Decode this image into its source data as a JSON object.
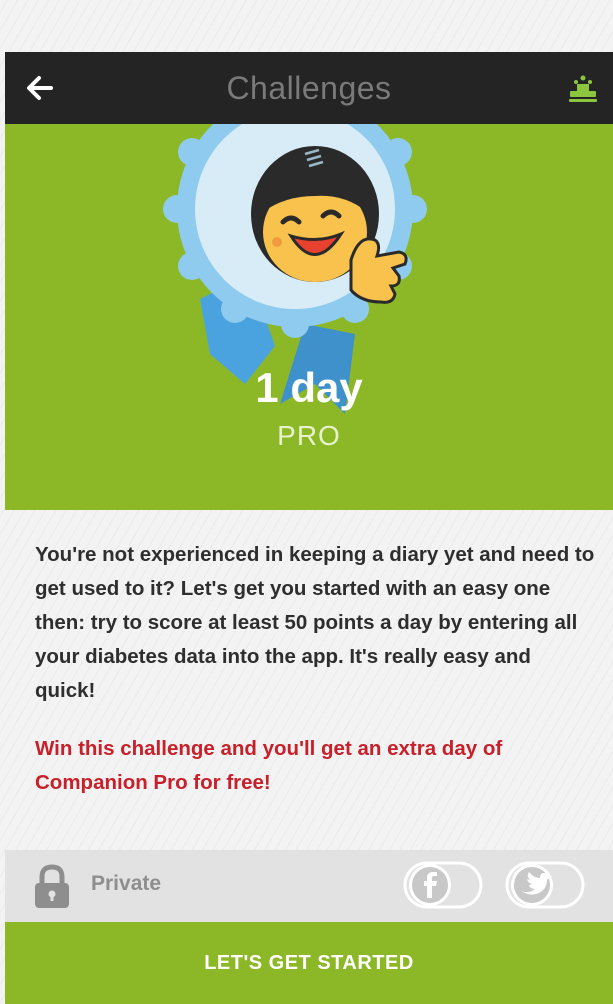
{
  "header": {
    "title": "Challenges",
    "back_icon": "back-arrow-icon",
    "share_icon": "podium-icon"
  },
  "challenge": {
    "duration": "1 day",
    "level": "PRO",
    "badge_icon": "thumbs-up-mascot-badge"
  },
  "description": "You're not experienced in keeping a diary yet and need to get used to it? Let's get you started with an easy one then: try to score at least 50 points a day by entering all your diabetes data into the app. It's really easy and quick!",
  "promo": "Win this challenge and you'll get an extra day of Companion Pro for free!",
  "privacy": {
    "label": "Private",
    "lock_icon": "lock-icon",
    "social": [
      {
        "name": "facebook",
        "icon": "facebook-icon"
      },
      {
        "name": "twitter",
        "icon": "twitter-icon"
      }
    ]
  },
  "cta": {
    "label": "LET'S GET STARTED"
  },
  "colors": {
    "header_bg": "#242424",
    "accent_green": "#8cb827",
    "promo_red": "#c8202a",
    "badge_blue": "#8fcbee"
  }
}
